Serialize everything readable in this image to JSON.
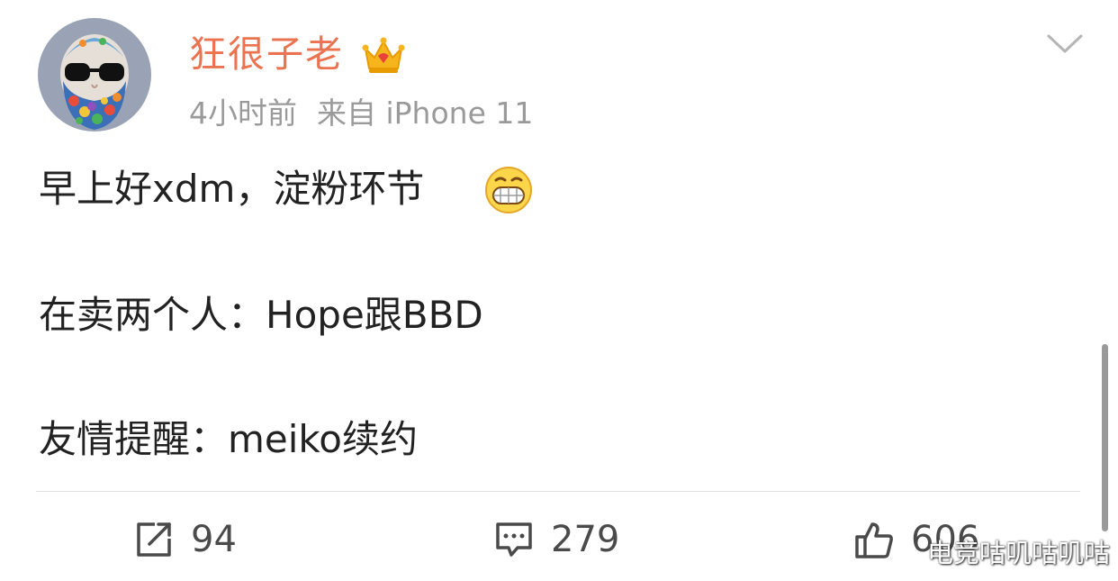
{
  "post": {
    "author": {
      "name": "狂很子老",
      "badge_icon": "crown-icon",
      "avatar_icon": "bearded-man-sunglasses-avatar"
    },
    "meta": {
      "time": "4小时前",
      "source": "来自 iPhone 11"
    },
    "menu_icon": "chevron-down-icon",
    "lines": [
      "早上好xdm，淀粉环节",
      "在卖两个人：Hope跟BBD",
      "友情提醒：meiko续约"
    ],
    "emoji_icon": "grin-emoji"
  },
  "actions": {
    "share": {
      "icon": "share-icon",
      "count": "94"
    },
    "comment": {
      "icon": "comment-icon",
      "count": "279"
    },
    "like": {
      "icon": "thumbs-up-icon",
      "count": "606"
    }
  },
  "watermark": "电竞咕叽咕叽咕",
  "colors": {
    "author": "#eb7350",
    "meta": "#9a9a9a",
    "text": "#222222",
    "actions": "#4a4a4a"
  }
}
